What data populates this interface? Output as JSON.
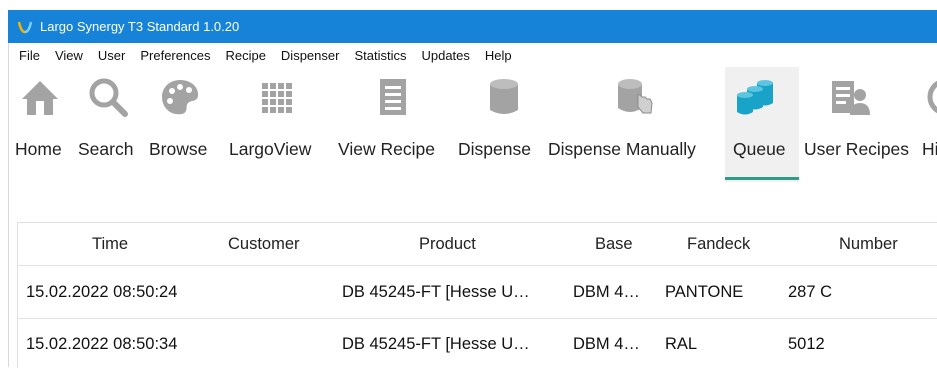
{
  "window": {
    "title": "Largo Synergy T3 Standard 1.0.20"
  },
  "menu": [
    "File",
    "View",
    "User",
    "Preferences",
    "Recipe",
    "Dispenser",
    "Statistics",
    "Updates",
    "Help"
  ],
  "toolbar": [
    {
      "label": "Home",
      "icon": "home-icon"
    },
    {
      "label": "Search",
      "icon": "search-icon"
    },
    {
      "label": "Browse",
      "icon": "palette-icon"
    },
    {
      "label": "LargoView",
      "icon": "grid-icon"
    },
    {
      "label": "View Recipe",
      "icon": "document-icon"
    },
    {
      "label": "Dispense",
      "icon": "can-icon"
    },
    {
      "label": "Dispense Manually",
      "icon": "can-hand-icon"
    },
    {
      "label": "Queue",
      "icon": "queue-cans-icon",
      "selected": true
    },
    {
      "label": "User Recipes",
      "icon": "user-recipes-icon"
    },
    {
      "label": "Hi",
      "icon": "history-icon"
    }
  ],
  "table": {
    "columns": [
      "Time",
      "Customer",
      "Product",
      "Base",
      "Fandeck",
      "Number"
    ],
    "rows": [
      {
        "time": "15.02.2022 08:50:24",
        "customer": "",
        "product": "DB 45245-FT [Hesse U…",
        "base": "DBM 4…",
        "fandeck": "PANTONE",
        "number": "287 C"
      },
      {
        "time": "15.02.2022 08:50:34",
        "customer": "",
        "product": "DB 45245-FT [Hesse U…",
        "base": "DBM 4…",
        "fandeck": "RAL",
        "number": "5012"
      }
    ]
  },
  "colors": {
    "titlebar": "#1683d8",
    "accent": "#2e9b8b",
    "icon_gray": "#a3a3a3",
    "queue_icon": "#1aa3c8"
  }
}
